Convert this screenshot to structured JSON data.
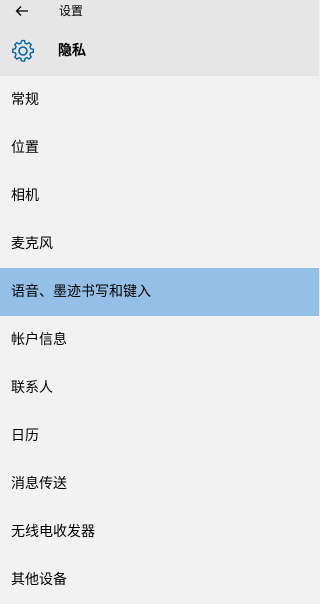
{
  "titlebar": {
    "back_icon": "back-arrow-icon",
    "app_title": "设置"
  },
  "header": {
    "icon": "gear-icon",
    "title": "隐私",
    "accent_color": "#0063b1"
  },
  "nav": {
    "selected_index": 4,
    "selected_color": "#94c0e8",
    "items": [
      {
        "label": "常规"
      },
      {
        "label": "位置"
      },
      {
        "label": "相机"
      },
      {
        "label": "麦克风"
      },
      {
        "label": "语音、墨迹书写和键入"
      },
      {
        "label": "帐户信息"
      },
      {
        "label": "联系人"
      },
      {
        "label": "日历"
      },
      {
        "label": "消息传送"
      },
      {
        "label": "无线电收发器"
      },
      {
        "label": "其他设备"
      }
    ]
  }
}
